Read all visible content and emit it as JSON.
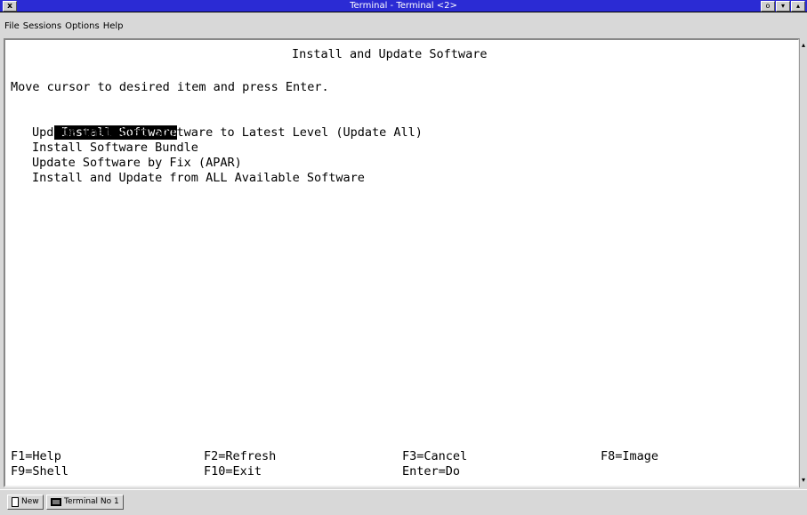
{
  "window": {
    "title": "Terminal - Terminal <2>",
    "close_glyph": "x",
    "ctrl_glyphs": [
      "o",
      "▾",
      "▴"
    ]
  },
  "menubar": [
    "File",
    "Sessions",
    "Options",
    "Help"
  ],
  "screen": {
    "title": "Install and Update Software",
    "instruction": "Move cursor to desired item and press Enter.",
    "items": [
      "Install Software",
      "Update Installed Software to Latest Level (Update All)",
      "Install Software Bundle",
      "Update Software by Fix (APAR)",
      "Install and Update from ALL Available Software"
    ],
    "selected_index": 0,
    "fkeys_row1": [
      "F1=Help",
      "F2=Refresh",
      "F3=Cancel",
      "F8=Image"
    ],
    "fkeys_row2": [
      "F9=Shell",
      "F10=Exit",
      "Enter=Do"
    ]
  },
  "taskbar": {
    "new_label": "New",
    "terminal_label": "Terminal No 1"
  }
}
